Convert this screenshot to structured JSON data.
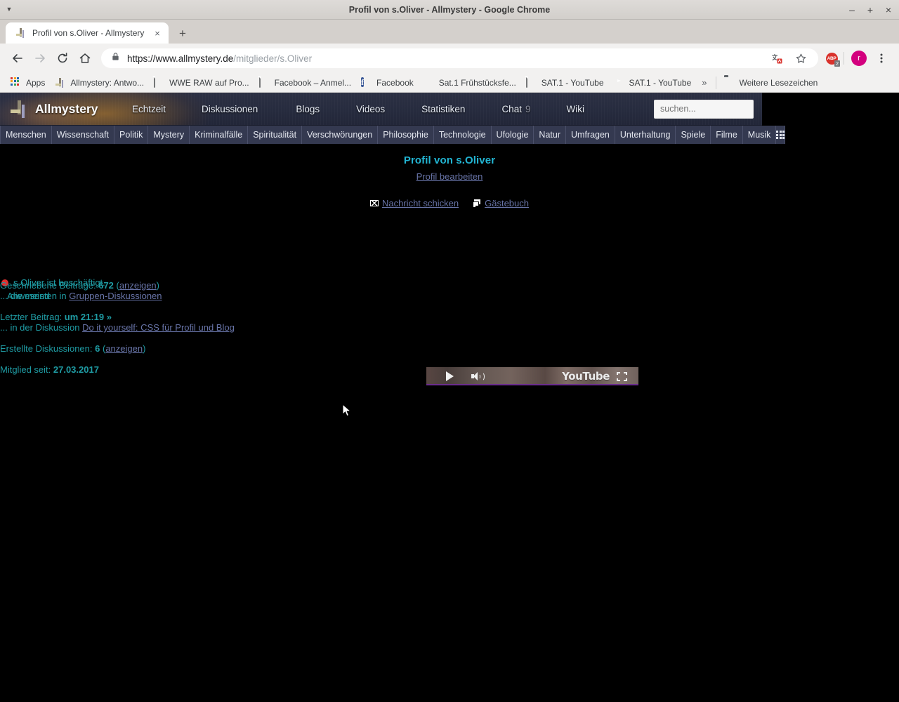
{
  "window": {
    "title": "Profil von s.Oliver - Allmystery - Google Chrome",
    "caret_icon": "caret-down-icon",
    "minimize_label": "–",
    "maximize_label": "+",
    "close_label": "×"
  },
  "tabs": [
    {
      "label": "Profil von s.Oliver - Allmystery",
      "favicon": "allmystery-icon",
      "close_label": "×"
    }
  ],
  "newtab_label": "+",
  "toolbar": {
    "back_icon": "back-arrow-icon",
    "forward_icon": "forward-arrow-icon",
    "reload_icon": "reload-icon",
    "home_icon": "home-icon",
    "lock_icon": "lock-icon",
    "url_prefix": "https://www.allmystery.de",
    "url_suffix": "/mitglieder/s.Oliver",
    "translate_icon": "translate-icon",
    "bookmark_icon": "star-icon",
    "adblock_label": "ABP",
    "adblock_badge": "2",
    "avatar_label": "r",
    "menu_icon": "three-dot-menu-icon"
  },
  "bookmarks": {
    "apps_label": "Apps",
    "items": [
      {
        "label": "Allmystery: Antwo...",
        "icon": "allmystery-icon"
      },
      {
        "label": "WWE RAW auf Pro...",
        "icon": "document-icon"
      },
      {
        "label": "Facebook – Anmel...",
        "icon": "document-icon"
      },
      {
        "label": "Facebook",
        "icon": "facebook-icon"
      },
      {
        "label": "Sat.1 Frühstücksfe...",
        "icon": "sat1-icon"
      },
      {
        "label": "SAT.1 - YouTube",
        "icon": "document-icon"
      },
      {
        "label": "SAT.1 - YouTube",
        "icon": "youtube-icon"
      }
    ],
    "overflow_label": "»",
    "other_label": "Weitere Lesezeichen",
    "other_icon": "folder-icon"
  },
  "site": {
    "logo_text": "Allmystery",
    "top_nav": [
      {
        "label": "Echtzeit",
        "count": ""
      },
      {
        "label": "Diskussionen",
        "count": ""
      },
      {
        "label": "Blogs",
        "count": ""
      },
      {
        "label": "Videos",
        "count": ""
      },
      {
        "label": "Statistiken",
        "count": ""
      },
      {
        "label": "Chat",
        "count": "9"
      },
      {
        "label": "Wiki",
        "count": ""
      }
    ],
    "search_placeholder": "suchen...",
    "search_value": "",
    "categories": [
      "Menschen",
      "Wissenschaft",
      "Politik",
      "Mystery",
      "Kriminalfälle",
      "Spiritualität",
      "Verschwörungen",
      "Philosophie",
      "Technologie",
      "Ufologie",
      "Natur",
      "Umfragen",
      "Unterhaltung",
      "Spiele",
      "Filme",
      "Musik"
    ],
    "grid_button_icon": "grid-icon"
  },
  "profile": {
    "title": "Profil von s.Oliver",
    "edit_link": "Profil bearbeiten",
    "message_link": "Nachricht schicken",
    "message_icon": "mail-icon",
    "guestbook_link": "Gästebuch",
    "guestbook_icon": "guestbook-icon",
    "status_icon": "busy-status-dot",
    "status_text": "s.Oliver ist beschäftigt.",
    "presence_text": "Anwesend",
    "stats": {
      "posts_label": "Geschriebene Beiträge:",
      "posts_value": "672",
      "posts_link_open": "(",
      "posts_link": "anzeigen",
      "posts_link_close": ")",
      "posts_most_prefix": "... die meisten in",
      "posts_most_link": "Gruppen-Diskussionen",
      "last_post_label": "Letzter Beitrag:",
      "last_post_value": "um 21:19 »",
      "last_post_prefix": "... in der Diskussion",
      "last_post_link": "Do it yourself: CSS für Profil und Blog",
      "threads_label": "Erstellte Diskussionen:",
      "threads_value": "6",
      "threads_link_open": "(",
      "threads_link": "anzeigen",
      "threads_link_close": ")",
      "member_label": "Mitglied seit:",
      "member_value": "27.03.2017"
    }
  },
  "video": {
    "play_icon": "play-icon",
    "volume_icon": "volume-icon",
    "brand_label": "YouTube",
    "fullscreen_icon": "fullscreen-icon"
  },
  "colors": {
    "accent_cyan": "#22b6d4",
    "stat_teal": "#1f9ca4",
    "link_purple": "#6874a8",
    "status_red": "#e03030",
    "nav_bg": "#343950",
    "header_bg": "#262b3e",
    "page_bg": "#000000",
    "progress_purple": "#6b2d8e"
  }
}
